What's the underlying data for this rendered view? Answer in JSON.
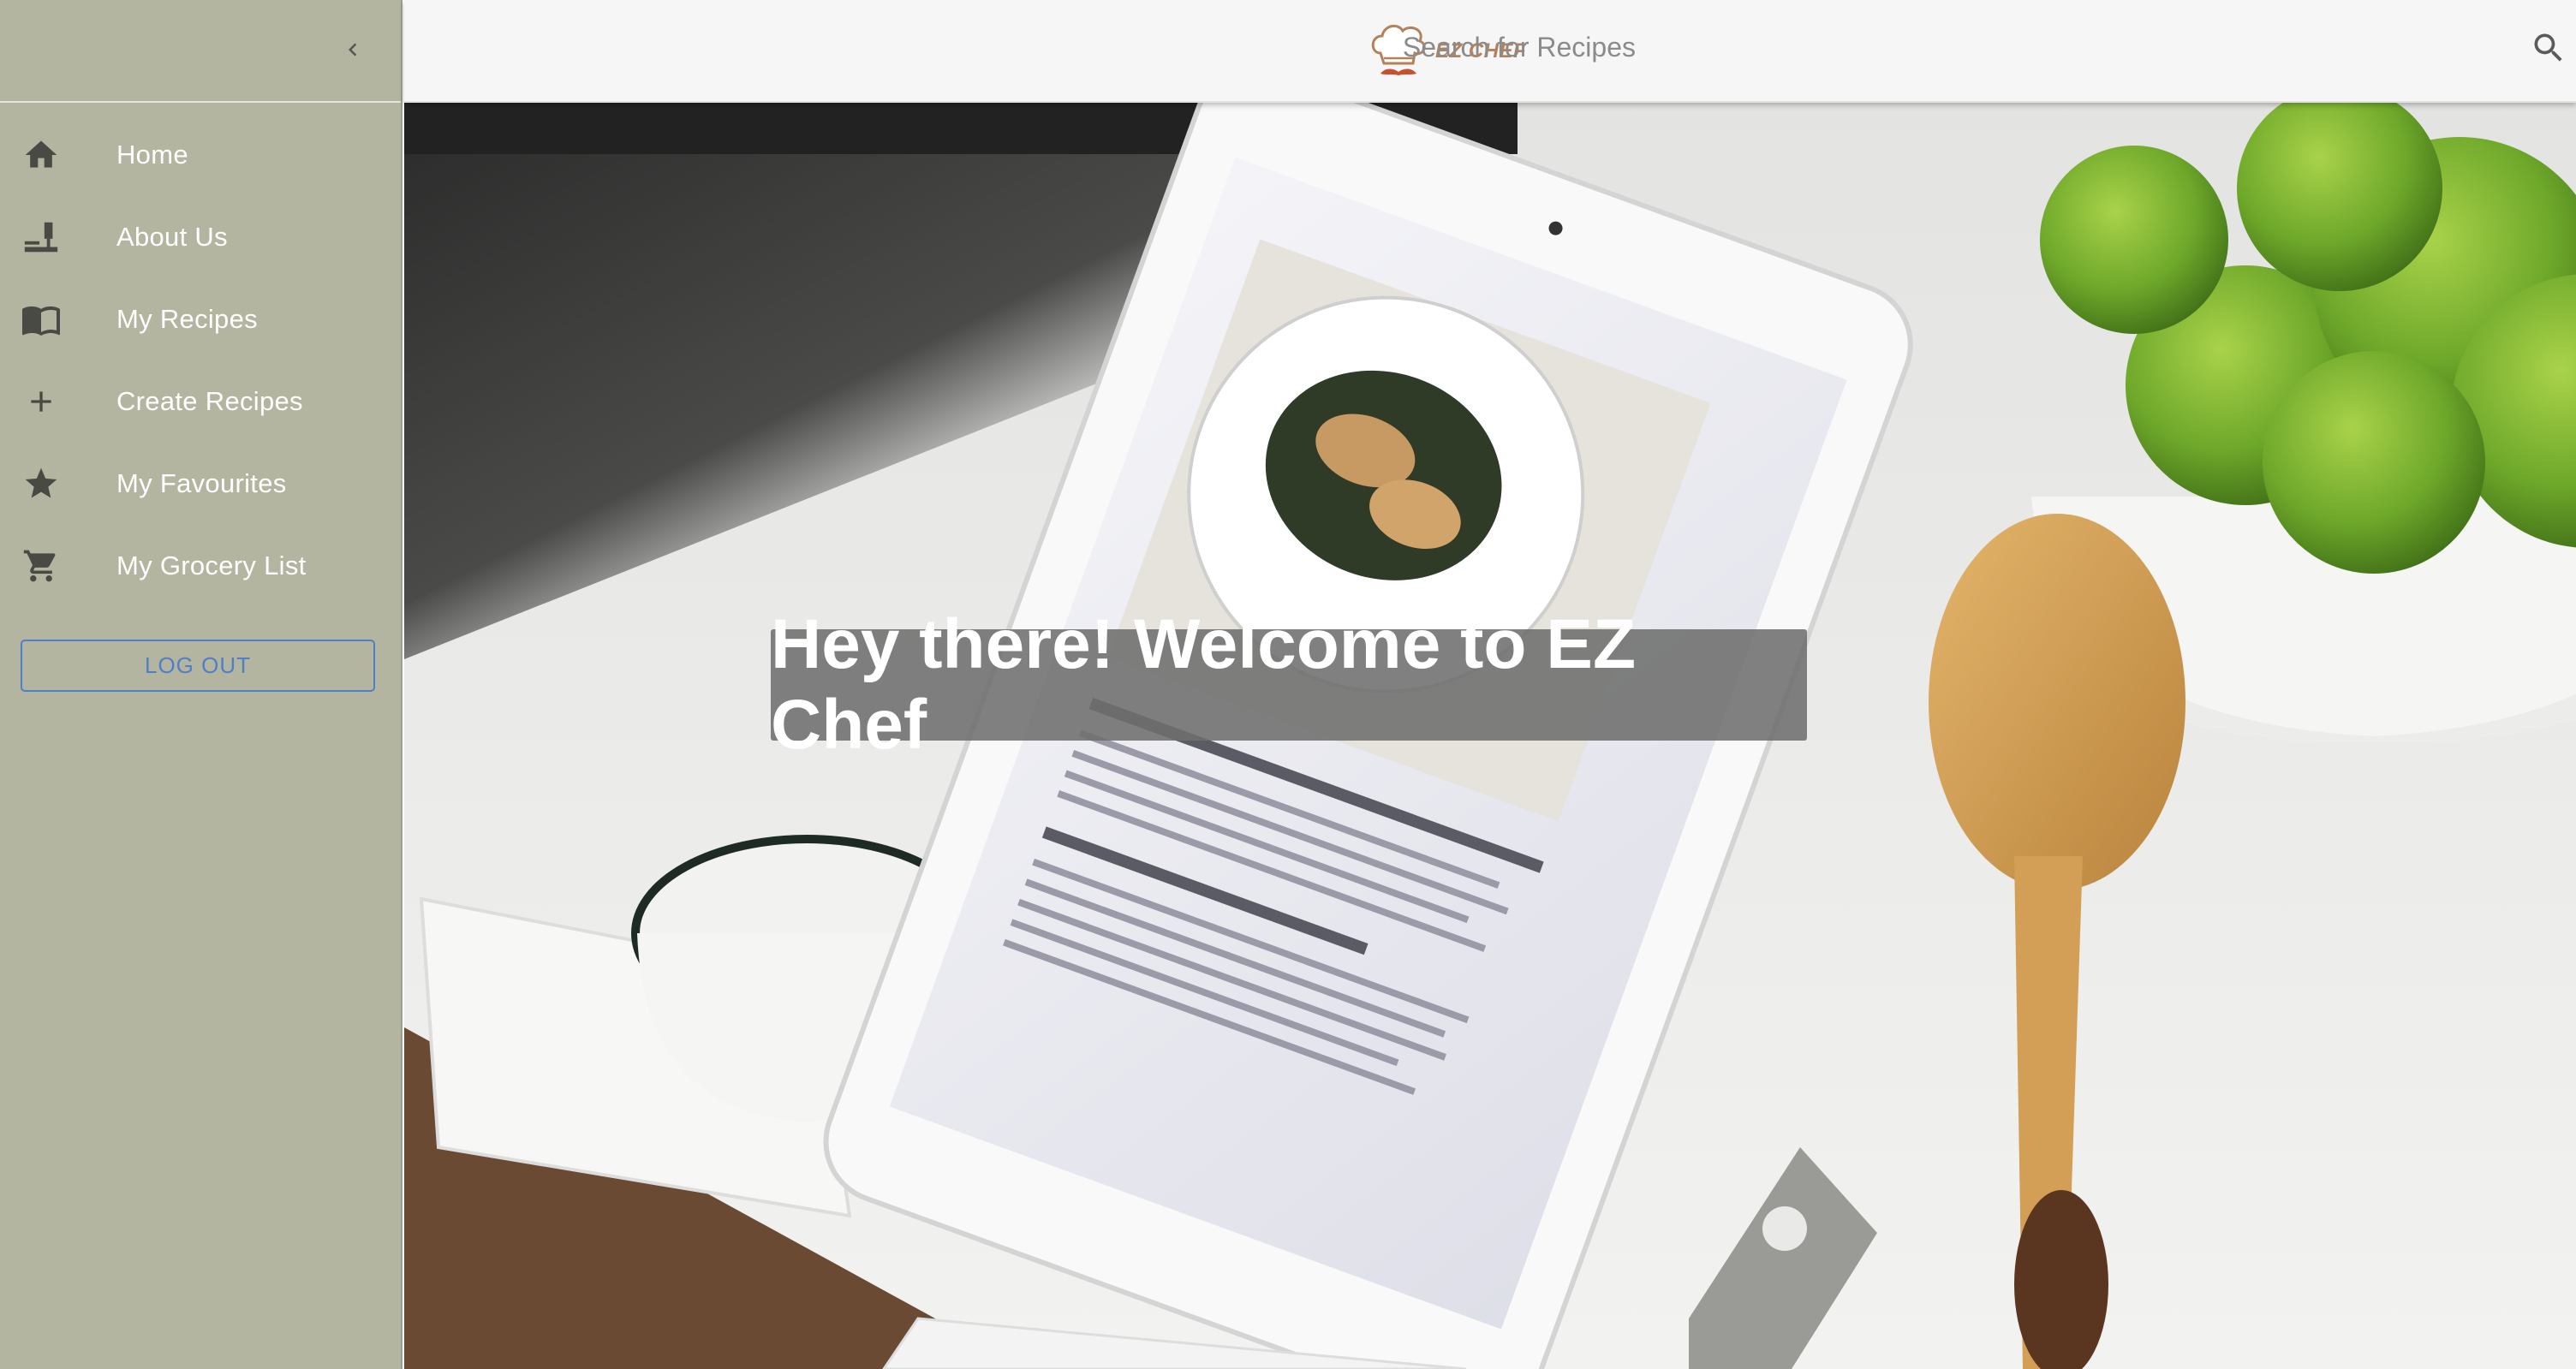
{
  "brand": {
    "name": "EZ CHEF",
    "accent": "#b5815a"
  },
  "sidebar": {
    "background": "#b3b5a0",
    "collapse_icon": "chevron-left-icon",
    "items": [
      {
        "label": "Home",
        "icon": "home-icon"
      },
      {
        "label": "About Us",
        "icon": "chef-knife-icon"
      },
      {
        "label": "My Recipes",
        "icon": "book-icon"
      },
      {
        "label": "Create Recipes",
        "icon": "plus-icon"
      },
      {
        "label": "My Favourites",
        "icon": "star-icon"
      },
      {
        "label": "My Grocery List",
        "icon": "cart-icon"
      }
    ],
    "logout_label": "LOG OUT"
  },
  "header": {
    "search": {
      "placeholder": "Search for Recipes",
      "value": ""
    },
    "search_icon": "search-icon"
  },
  "hero": {
    "welcome_text": "Hey there! Welcome to EZ Chef"
  }
}
